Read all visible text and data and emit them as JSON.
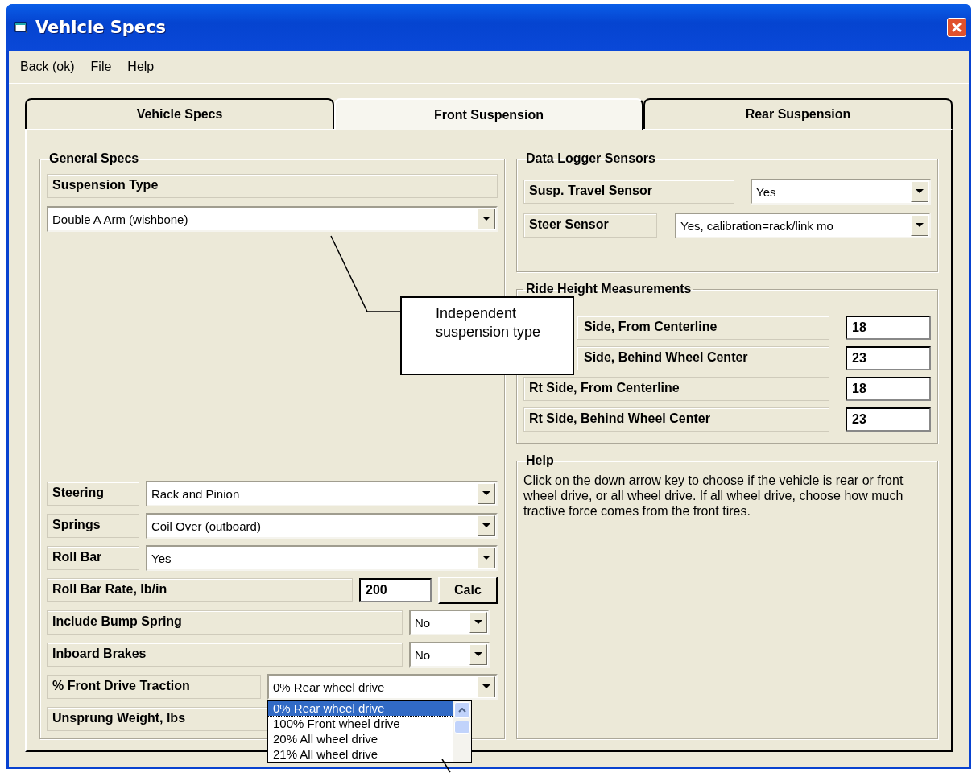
{
  "window": {
    "title": "Vehicle Specs"
  },
  "menu": [
    "Back (ok)",
    "File",
    "Help"
  ],
  "tabs": [
    {
      "label": "Vehicle Specs",
      "selected": false
    },
    {
      "label": "Front Suspension",
      "selected": true
    },
    {
      "label": "Rear Suspension",
      "selected": false
    }
  ],
  "general_specs": {
    "title": "General Specs",
    "suspension_type": {
      "label": "Suspension Type",
      "value": "Double A Arm (wishbone)"
    },
    "rows": [
      {
        "kind": "select",
        "label": "Steering",
        "value": "Rack and Pinion"
      },
      {
        "kind": "select",
        "label": "Springs",
        "value": "Coil Over (outboard)"
      },
      {
        "kind": "select",
        "label": "Roll Bar",
        "value": "Yes"
      },
      {
        "kind": "number",
        "label": "Roll Bar Rate, lb/in",
        "value": "200",
        "button": "Calc"
      },
      {
        "kind": "small_select",
        "label": "Include Bump Spring",
        "value": "No"
      },
      {
        "kind": "small_select",
        "label": "Inboard Brakes",
        "value": "No"
      },
      {
        "kind": "open_select",
        "label": "% Front Drive Traction",
        "value": "0% Rear wheel drive",
        "options": [
          {
            "label": "0% Rear wheel drive",
            "selected": true
          },
          {
            "label": "100% Front wheel drive",
            "selected": false
          },
          {
            "label": "20% All wheel drive",
            "selected": false
          },
          {
            "label": "21% All wheel drive",
            "selected": false
          }
        ]
      },
      {
        "kind": "label",
        "label": "Unsprung Weight, lbs"
      }
    ]
  },
  "data_logger": {
    "title": "Data Logger Sensors",
    "rows": [
      {
        "label": "Susp. Travel Sensor",
        "value": "Yes"
      },
      {
        "label": "Steer Sensor",
        "value": "Yes, calibration=rack/link mo"
      }
    ]
  },
  "ride_height": {
    "title": "Ride Height Measurements",
    "rows": [
      {
        "label": "Side, From Centerline",
        "value": "18"
      },
      {
        "label": "Side, Behind Wheel Center",
        "value": "23"
      },
      {
        "label": "Rt Side, From Centerline",
        "value": "18"
      },
      {
        "label": "Rt Side, Behind Wheel Center",
        "value": "23"
      }
    ]
  },
  "help": {
    "title": "Help",
    "text": "Click on the down arrow key to choose if the vehicle is rear or front wheel drive, or all wheel drive.  If all wheel drive, choose how much tractive force comes from the front tires."
  },
  "callout": {
    "text": "Independent suspension type"
  }
}
